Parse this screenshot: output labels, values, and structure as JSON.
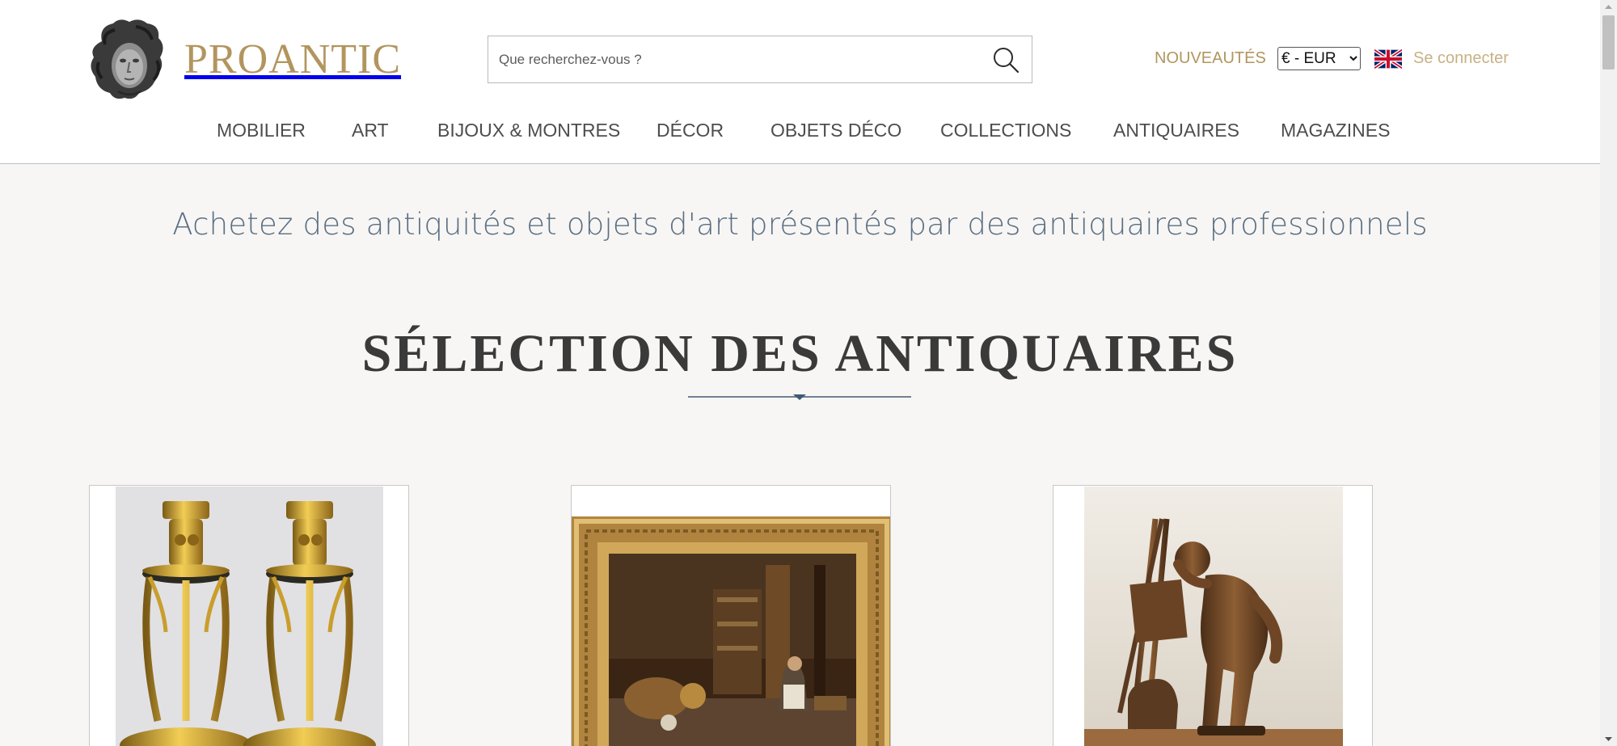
{
  "brand": {
    "name": "PROANTIC"
  },
  "search": {
    "placeholder": "Que recherchez-vous ?"
  },
  "header_links": {
    "new_label": "NOUVEAUTÉS",
    "currency_selected": "€ - EUR",
    "login_label": "Se connecter"
  },
  "nav": {
    "items": [
      {
        "label": "MOBILIER"
      },
      {
        "label": "ART"
      },
      {
        "label": "BIJOUX & MONTRES"
      },
      {
        "label": "DÉCOR"
      },
      {
        "label": "OBJETS DÉCO"
      },
      {
        "label": "COLLECTIONS"
      },
      {
        "label": "ANTIQUAIRES"
      },
      {
        "label": "MAGAZINES"
      }
    ]
  },
  "main": {
    "tagline": "Achetez des antiquités et objets d'art présentés par des antiquaires professionnels",
    "section_title": "SÉLECTION DES ANTIQUAIRES"
  },
  "colors": {
    "brand_gold": "#b2955e",
    "tagline_blue": "#5a6e83",
    "page_background": "#f7f6f4"
  },
  "icons": {
    "search": "search-icon",
    "flag": "uk-flag-icon",
    "logo": "logo-head-icon"
  }
}
